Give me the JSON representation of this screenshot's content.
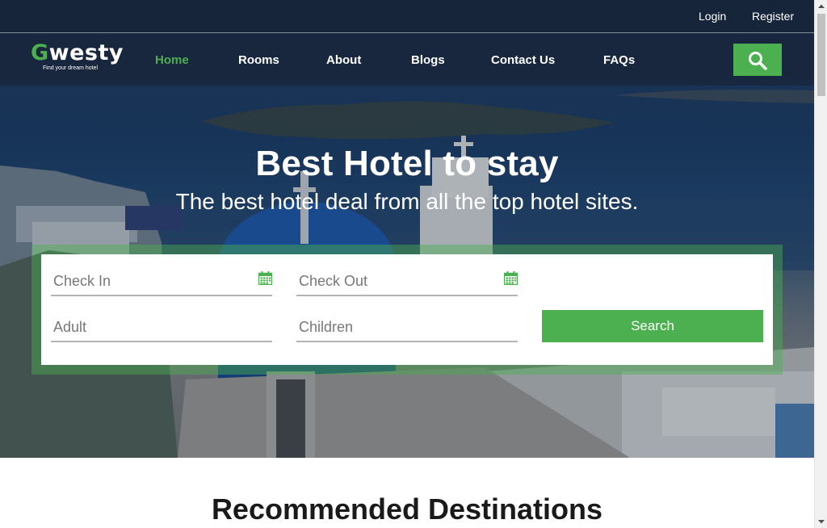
{
  "topbar": {
    "login": "Login",
    "register": "Register"
  },
  "brand": {
    "name_initial": "G",
    "name_rest": "westy",
    "tagline": "Find your dream hotel"
  },
  "nav": {
    "home": "Home",
    "rooms": "Rooms",
    "about": "About",
    "blogs": "Blogs",
    "contact": "Contact Us",
    "faqs": "FAQs",
    "search_icon": "search-icon"
  },
  "hero": {
    "title": "Best Hotel to stay",
    "subtitle": "The best hotel deal from all the top hotel sites."
  },
  "booking": {
    "check_in_placeholder": "Check In",
    "check_out_placeholder": "Check Out",
    "adult_placeholder": "Adult",
    "children_placeholder": "Children",
    "search_label": "Search",
    "calendar_icon": "calendar-icon"
  },
  "section": {
    "recommended_title": "Recommended Destinations"
  },
  "colors": {
    "accent": "#4caf50",
    "nav_bg": "#1a2940",
    "text_dark": "#1a1a1a"
  }
}
